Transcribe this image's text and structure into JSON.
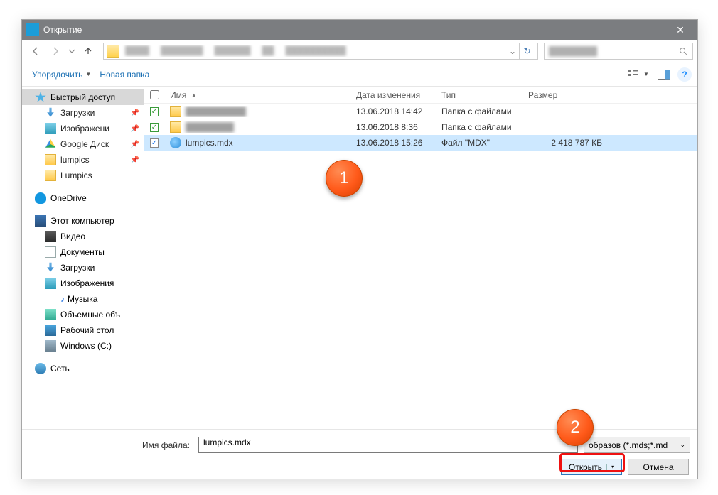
{
  "window": {
    "title": "Открытие"
  },
  "toolbar": {
    "organize": "Упорядочить",
    "newfolder": "Новая папка"
  },
  "tree": {
    "quick_access": "Быстрый доступ",
    "downloads": "Загрузки",
    "pictures": "Изображени",
    "gdrive": "Google Диск",
    "lumpics": "lumpics",
    "lumpics2": "Lumpics",
    "onedrive": "OneDrive",
    "this_pc": "Этот компьютер",
    "video": "Видео",
    "documents": "Документы",
    "downloads2": "Загрузки",
    "pictures2": "Изображения",
    "music": "Музыка",
    "volumes": "Объемные объ",
    "desktop": "Рабочий стол",
    "drive_c": "Windows (C:)",
    "network": "Сеть"
  },
  "columns": {
    "name": "Имя",
    "date": "Дата изменения",
    "type": "Тип",
    "size": "Размер"
  },
  "files": [
    {
      "name": "",
      "date": "13.06.2018 14:42",
      "type": "Папка с файлами",
      "size": "",
      "blur": true,
      "checked": false,
      "folder": true
    },
    {
      "name": "",
      "date": "13.06.2018 8:36",
      "type": "Папка с файлами",
      "size": "",
      "blur": true,
      "checked": false,
      "folder": true
    },
    {
      "name": "lumpics.mdx",
      "date": "13.06.2018 15:26",
      "type": "Файл \"MDX\"",
      "size": "2 418 787 КБ",
      "blur": false,
      "checked": true,
      "folder": false,
      "selected": true
    }
  ],
  "footer": {
    "filename_label": "Имя файла:",
    "filename_value": "lumpics.mdx",
    "filetype": "образов (*.mds;*.md",
    "open": "Открыть",
    "cancel": "Отмена"
  },
  "badges": {
    "one": "1",
    "two": "2"
  }
}
